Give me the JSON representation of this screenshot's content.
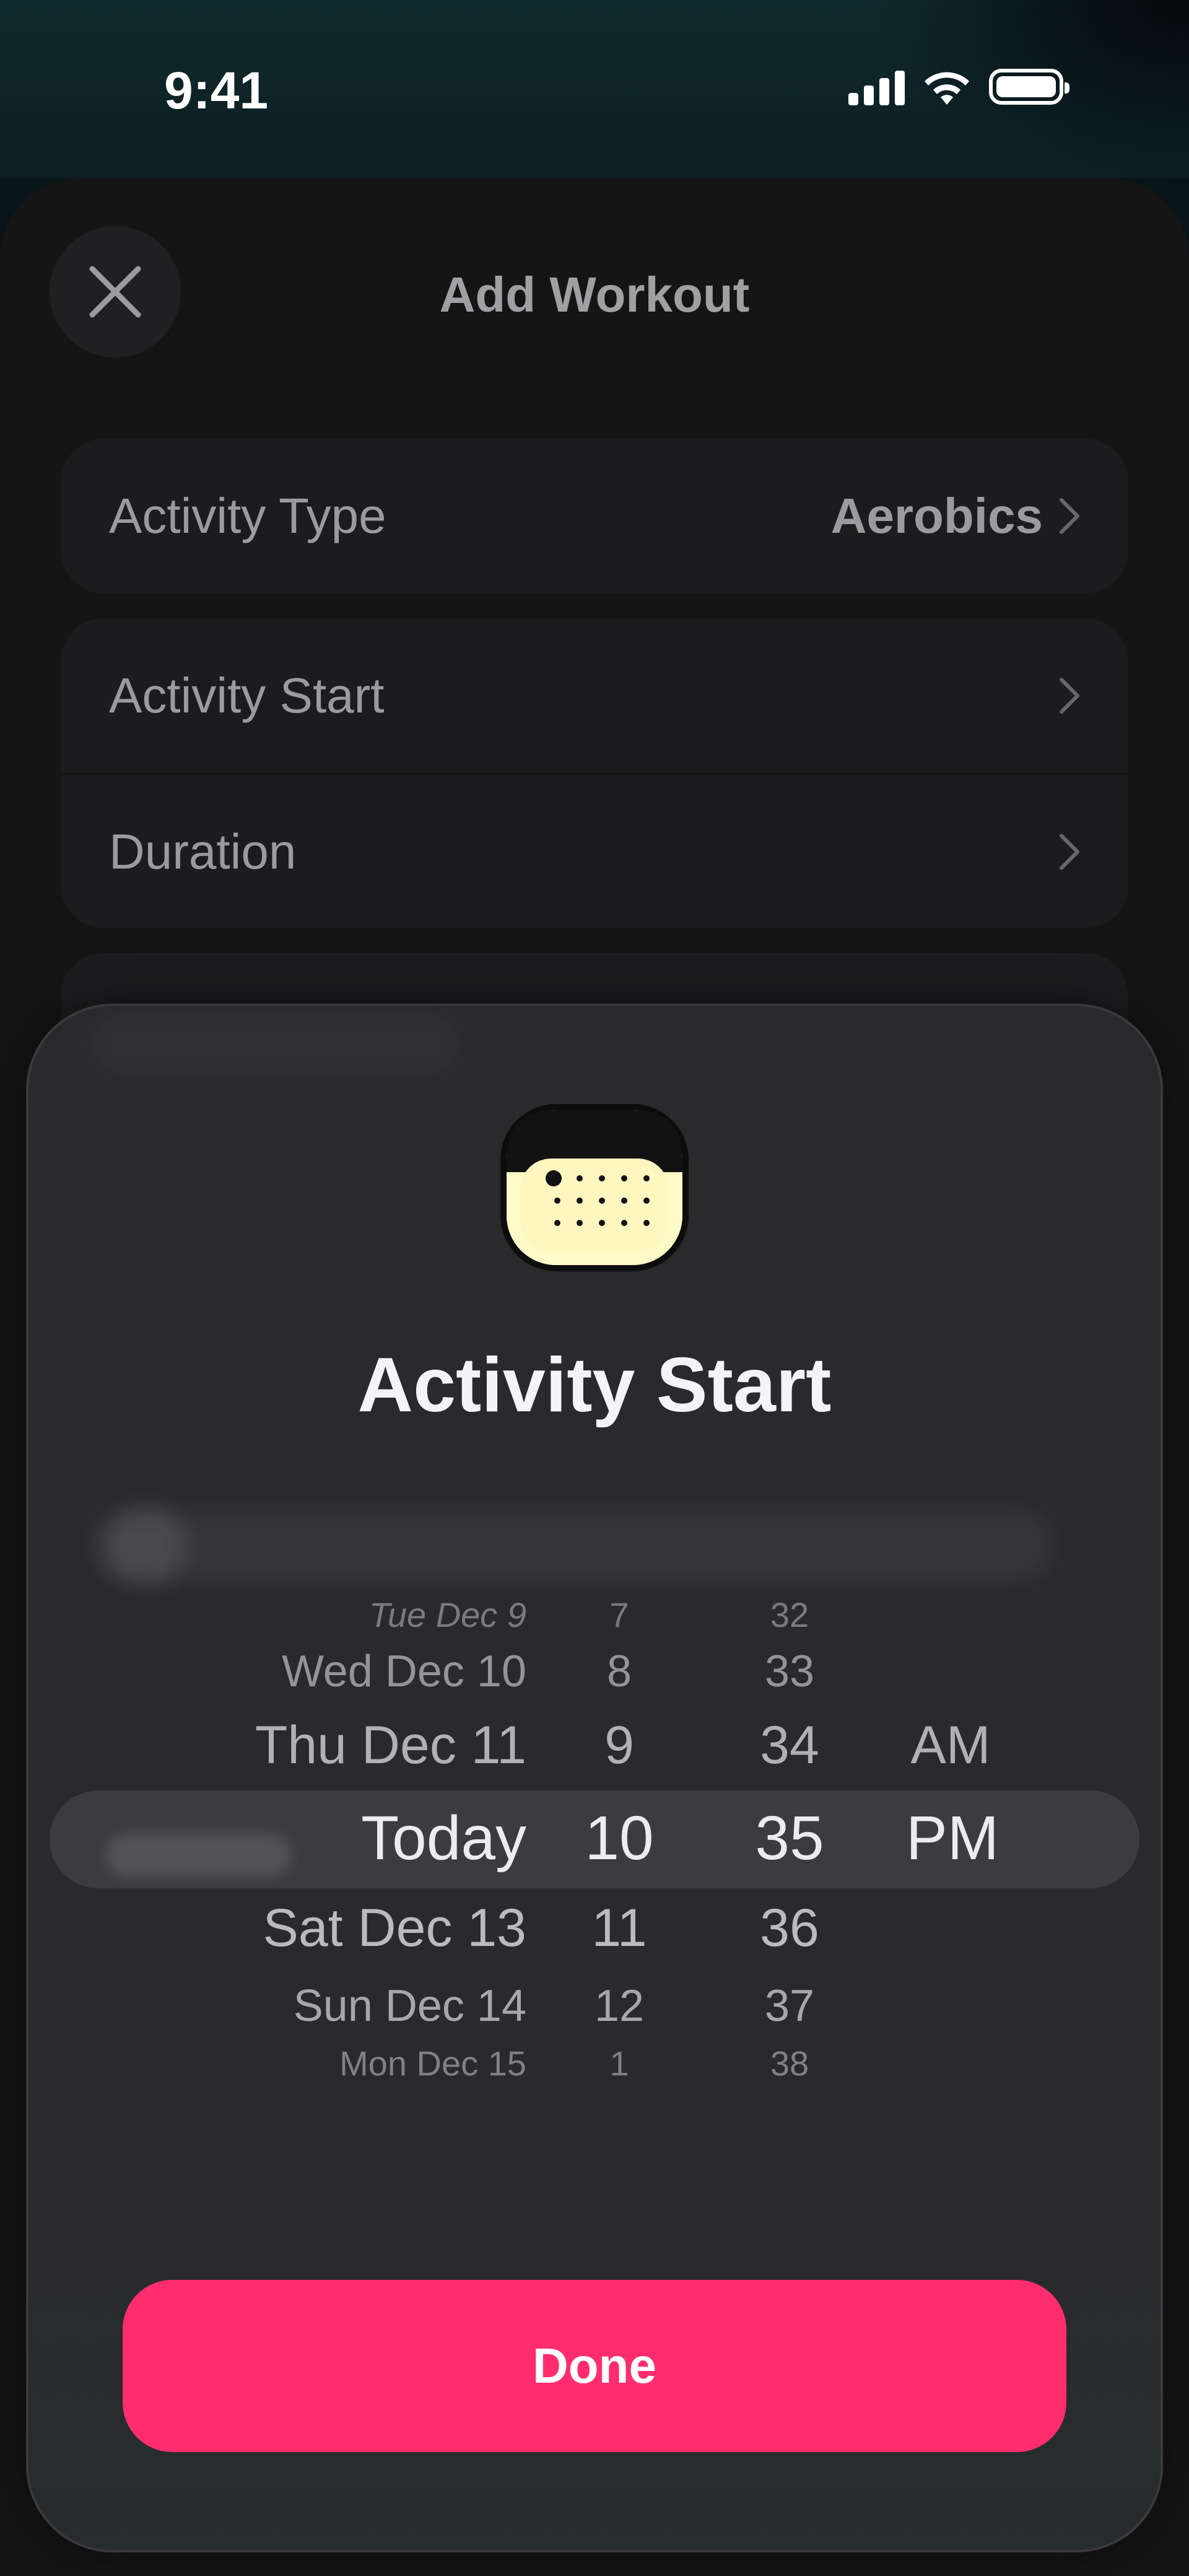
{
  "status_bar": {
    "time": "9:41"
  },
  "header": {
    "title": "Add Workout",
    "close_icon": "close-icon"
  },
  "form": {
    "activity_type": {
      "label": "Activity Type",
      "value": "Aerobics"
    },
    "activity_start": {
      "label": "Activity Start"
    },
    "duration": {
      "label": "Duration"
    }
  },
  "modal": {
    "title": "Activity Start",
    "icon": "calendar-icon",
    "done_label": "Done",
    "accent_color": "#ff2d6e"
  },
  "picker": {
    "dates": [
      "Tue Dec 9",
      "Wed Dec 10",
      "Thu Dec 11",
      "Today",
      "Sat Dec 13",
      "Sun Dec 14",
      "Mon Dec 15"
    ],
    "hours": [
      "7",
      "8",
      "9",
      "10",
      "11",
      "12",
      "1"
    ],
    "minutes": [
      "32",
      "33",
      "34",
      "35",
      "36",
      "37",
      "38"
    ],
    "meridiem": [
      "AM",
      "PM"
    ],
    "selected": {
      "date": "Today",
      "hour": "10",
      "minute": "35",
      "meridiem": "PM"
    }
  }
}
